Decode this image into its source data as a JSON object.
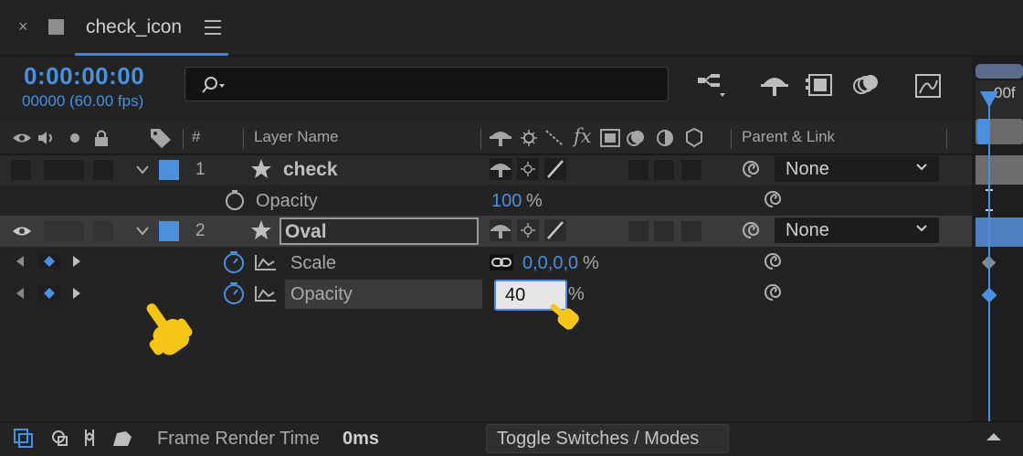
{
  "tab": {
    "close_label": "×",
    "title": "check_icon"
  },
  "timecode": {
    "value": "0:00:00:00",
    "frames": "00000 (60.00 fps)"
  },
  "search": {
    "placeholder": ""
  },
  "ruler": {
    "label": "00f"
  },
  "columns": {
    "number": "#",
    "layer_name": "Layer Name",
    "parent_link": "Parent & Link",
    "fx": "fx"
  },
  "layers": [
    {
      "number": "1",
      "name": "check",
      "parent": "None",
      "properties": [
        {
          "name": "Opacity",
          "value_num": "100",
          "unit": "%"
        }
      ]
    },
    {
      "number": "2",
      "name": "Oval",
      "parent": "None",
      "properties": [
        {
          "name": "Scale",
          "value_num": "0,0,0,0",
          "unit": "%"
        },
        {
          "name": "Opacity",
          "value_num": "40",
          "unit": "%"
        }
      ]
    }
  ],
  "footer": {
    "label": "Frame Render Time",
    "value": "0ms",
    "toggle": "Toggle Switches / Modes"
  },
  "colors": {
    "accent": "#4a8fe0",
    "label_blue": "#4d8fdb",
    "pointer": "#f5c518"
  }
}
